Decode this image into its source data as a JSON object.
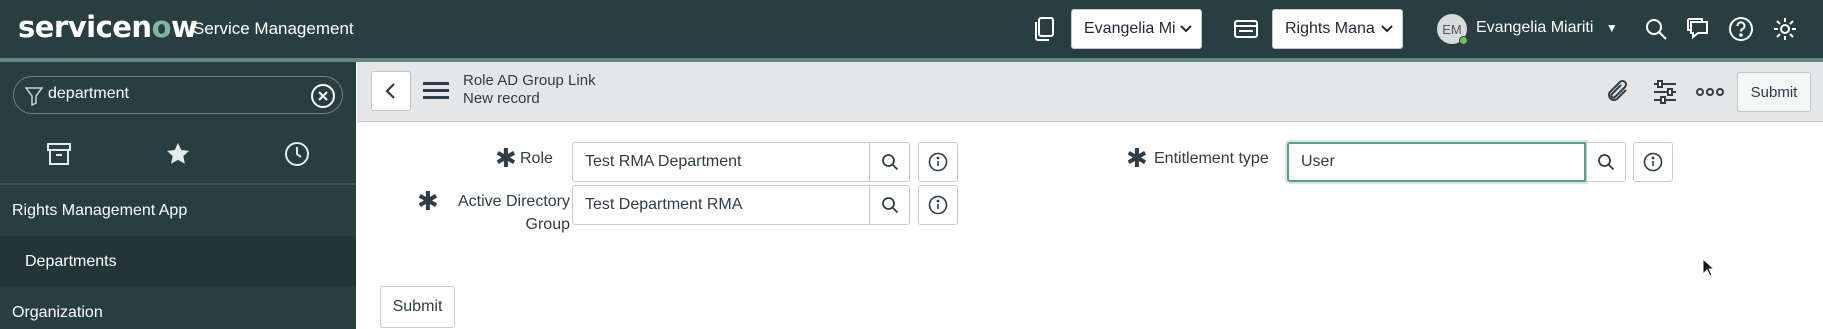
{
  "topbar": {
    "logo_prefix": "servicen",
    "logo_o": "o",
    "logo_suffix": "w",
    "app_title": "Service Management",
    "domain_select": "Evangelia Mi",
    "app_select": "Rights Mana",
    "avatar_initials": "EM",
    "user_name": "Evangelia Miariti",
    "icons": [
      "domain-picker-icon",
      "app-picker-icon",
      "search-icon",
      "chat-icon",
      "help-icon",
      "settings-icon"
    ]
  },
  "sidebar": {
    "filter_value": "department",
    "tabs": [
      "all-apps-icon",
      "favorites-icon",
      "history-icon"
    ],
    "items": [
      {
        "label": "Rights Management App"
      },
      {
        "label": "Departments"
      },
      {
        "label": "Organization"
      }
    ]
  },
  "header": {
    "table_label": "Role AD Group Link",
    "record_label": "New record",
    "submit_label": "Submit",
    "icons": [
      "back-icon",
      "menu-icon",
      "attachment-icon",
      "personalize-icon",
      "more-icon"
    ]
  },
  "form": {
    "role_label": "Role",
    "role_value": "Test RMA Department",
    "ad_group_label_line1": "Active Directory",
    "ad_group_label_line2": "Group",
    "ad_group_value": "Test Department RMA",
    "entitlement_label": "Entitlement type",
    "entitlement_value": "User",
    "required_marker": "✱",
    "submit_label": "Submit"
  },
  "colors": {
    "topbar": "#293e40",
    "accent": "#81b5a1",
    "active_field": "#5f9e95"
  }
}
